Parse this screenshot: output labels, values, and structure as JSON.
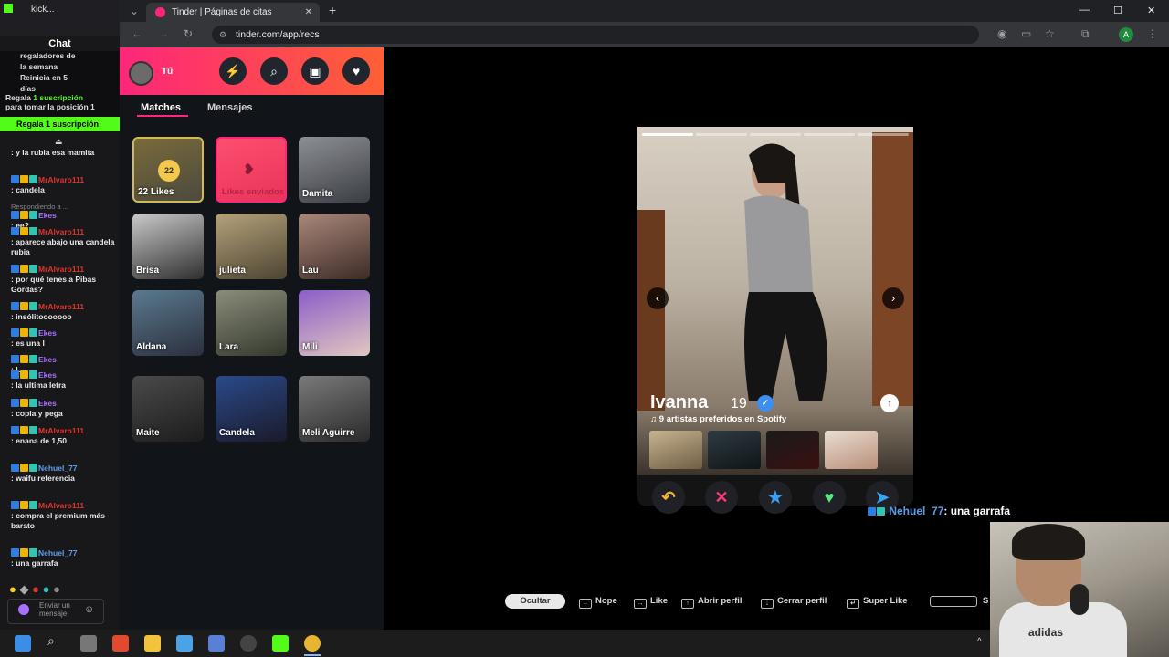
{
  "chat": {
    "tabs_label": "kick...",
    "title": "Chat",
    "gift_lines": [
      "regaladores de",
      "la semana",
      "Reinicia en 5",
      "días"
    ],
    "gift_prompt_1": "Regala",
    "gift_prompt_2": "1 suscripción",
    "gift_prompt_3": "para tomar la posición 1",
    "gift_button": "Regala 1 suscripción",
    "messages": [
      {
        "user": "",
        "text": ": y la rubia esa mamita"
      },
      {
        "user": "MrAlvaro111",
        "text": ": candela"
      },
      {
        "user": "",
        "text": "Respondiendo a ..."
      },
      {
        "user": "Ekes",
        "text": ": ee?"
      },
      {
        "user": "MrAlvaro111",
        "text": ": aparece abajo una candela rubia"
      },
      {
        "user": "MrAlvaro111",
        "text": ": por qué tenes a Pibas Gordas?"
      },
      {
        "user": "MrAlvaro111",
        "text": ": insólitooooooo"
      },
      {
        "user": "Ekes",
        "text": ": es una l"
      },
      {
        "user": "Ekes",
        "text": ": L"
      },
      {
        "user": "Ekes",
        "text": ": la ultima letra"
      },
      {
        "user": "Ekes",
        "text": ": copia y pega"
      },
      {
        "user": "MrAlvaro111",
        "text": ": enana de 1,50"
      },
      {
        "user": "Nehuel_77",
        "text": ": waifu referencia"
      },
      {
        "user": "MrAlvaro111",
        "text": ": compra el premium más barato"
      },
      {
        "user": "Nehuel_77",
        "text": ": una garrafa"
      }
    ],
    "input_placeholder": "Enviar un mensaje"
  },
  "browser": {
    "tab_title": "Tinder | Páginas de citas",
    "url": "tinder.com/app/recs",
    "profile_initial": "A"
  },
  "sidebar": {
    "me_label": "Tú",
    "tabs": [
      "Matches",
      "Mensajes"
    ],
    "likes_count": "22",
    "likes_label": "22 Likes",
    "sent_label": "Likes enviados",
    "matches": [
      "Damita",
      "Brisa",
      "julieta",
      "Lau",
      "Aldana",
      "Lara",
      "Mili",
      "Maite",
      "Candela",
      "Meli Aguirre"
    ]
  },
  "profile": {
    "name": "Ivanna",
    "age": "19",
    "spotify": "9 artistas preferidos en Spotify"
  },
  "overlay": {
    "user": "Nehuel_77",
    "text": ": una garrafa"
  },
  "shortcuts": {
    "hide": "Ocultar",
    "items": [
      "Nope",
      "Like",
      "Abrir perfil",
      "Cerrar perfil",
      "Super Like"
    ],
    "trailing": "S"
  },
  "webcam": {
    "shirt_text": "adidas"
  },
  "colors": {
    "tinder_pink": "#fd267a",
    "tinder_orange": "#ff6036",
    "kick_green": "#53fc18"
  }
}
